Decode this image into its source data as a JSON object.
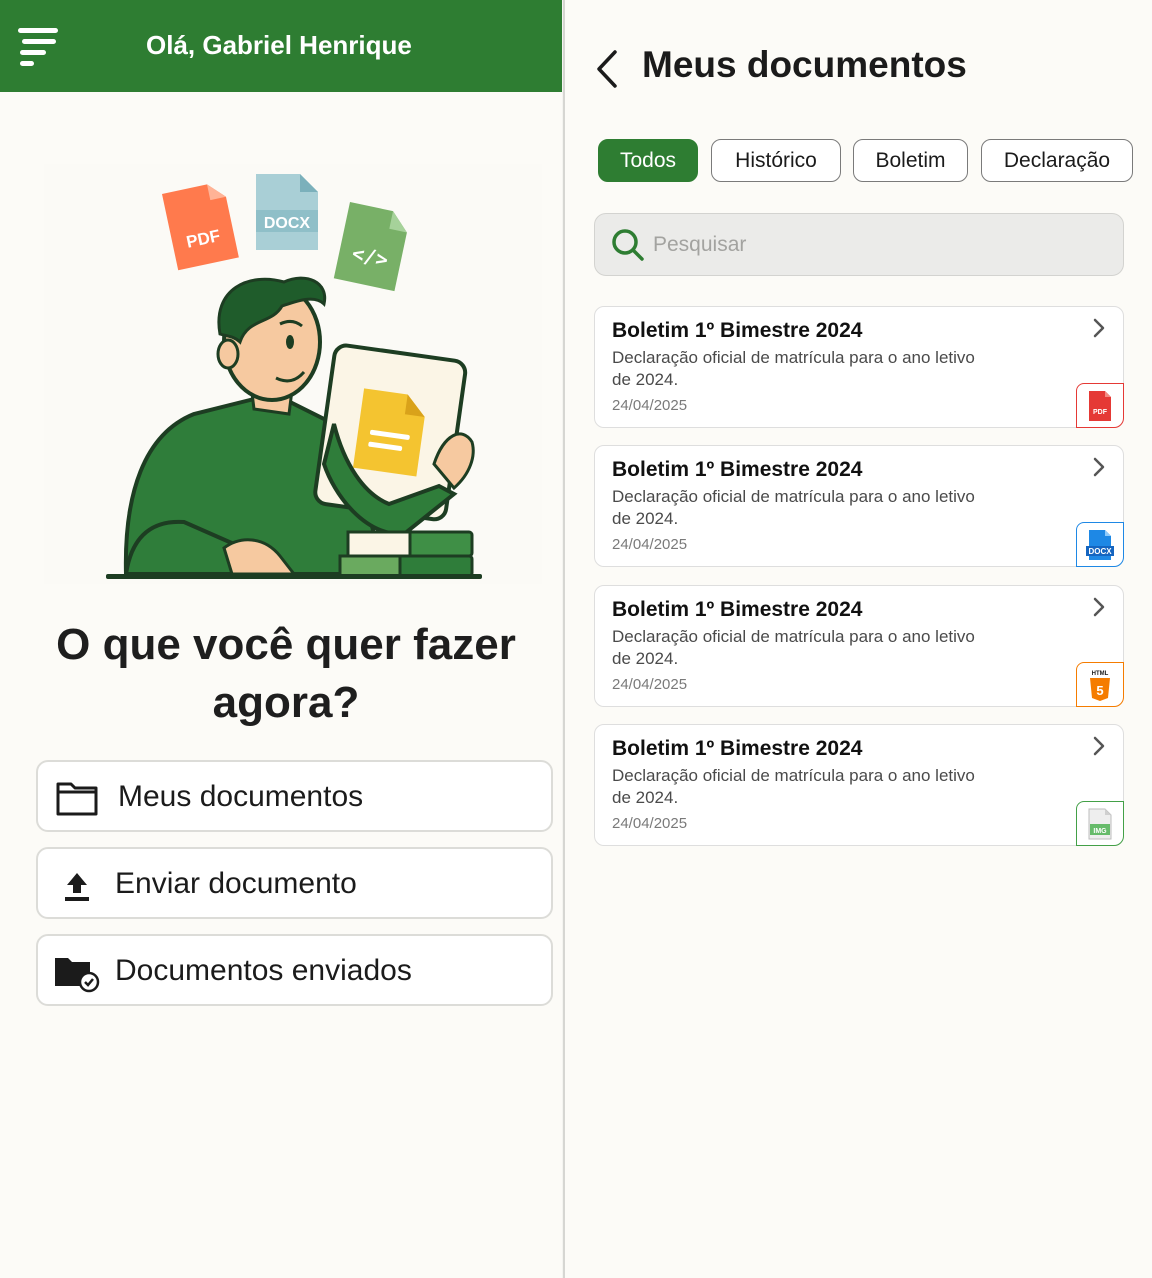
{
  "home": {
    "greeting": "Olá, Gabriel Henrique",
    "question": "O que você quer fazer agora?",
    "illustration_file_labels": [
      "PDF",
      "DOCX"
    ],
    "actions": [
      {
        "label": "Meus documentos",
        "icon": "folder-icon"
      },
      {
        "label": "Enviar documento",
        "icon": "upload-icon"
      },
      {
        "label": "Documentos enviados",
        "icon": "folder-check-icon"
      }
    ]
  },
  "documents": {
    "title": "Meus documentos",
    "filters": [
      {
        "label": "Todos",
        "active": true
      },
      {
        "label": "Histórico",
        "active": false
      },
      {
        "label": "Boletim",
        "active": false
      },
      {
        "label": "Declaração",
        "active": false
      }
    ],
    "search_placeholder": "Pesquisar",
    "items": [
      {
        "title": "Boletim 1º Bimestre 2024",
        "description": "Declaração oficial de matrícula para o ano letivo de 2024.",
        "date": "24/04/2025",
        "file_type": "PDF",
        "file_color": "#e53935"
      },
      {
        "title": "Boletim 1º Bimestre 2024",
        "description": "Declaração oficial de matrícula para o ano letivo de 2024.",
        "date": "24/04/2025",
        "file_type": "DOCX",
        "file_color": "#1e88e5"
      },
      {
        "title": "Boletim 1º Bimestre 2024",
        "description": "Declaração oficial de matrícula para o ano letivo de 2024.",
        "date": "24/04/2025",
        "file_type": "HTML",
        "file_color": "#f57c00"
      },
      {
        "title": "Boletim 1º Bimestre 2024",
        "description": "Declaração oficial de matrícula para o ano letivo de 2024.",
        "date": "24/04/2025",
        "file_type": "IMG",
        "file_color": "#43a047"
      }
    ]
  },
  "colors": {
    "primary": "#2e7d32",
    "background": "#fcfbf7"
  }
}
